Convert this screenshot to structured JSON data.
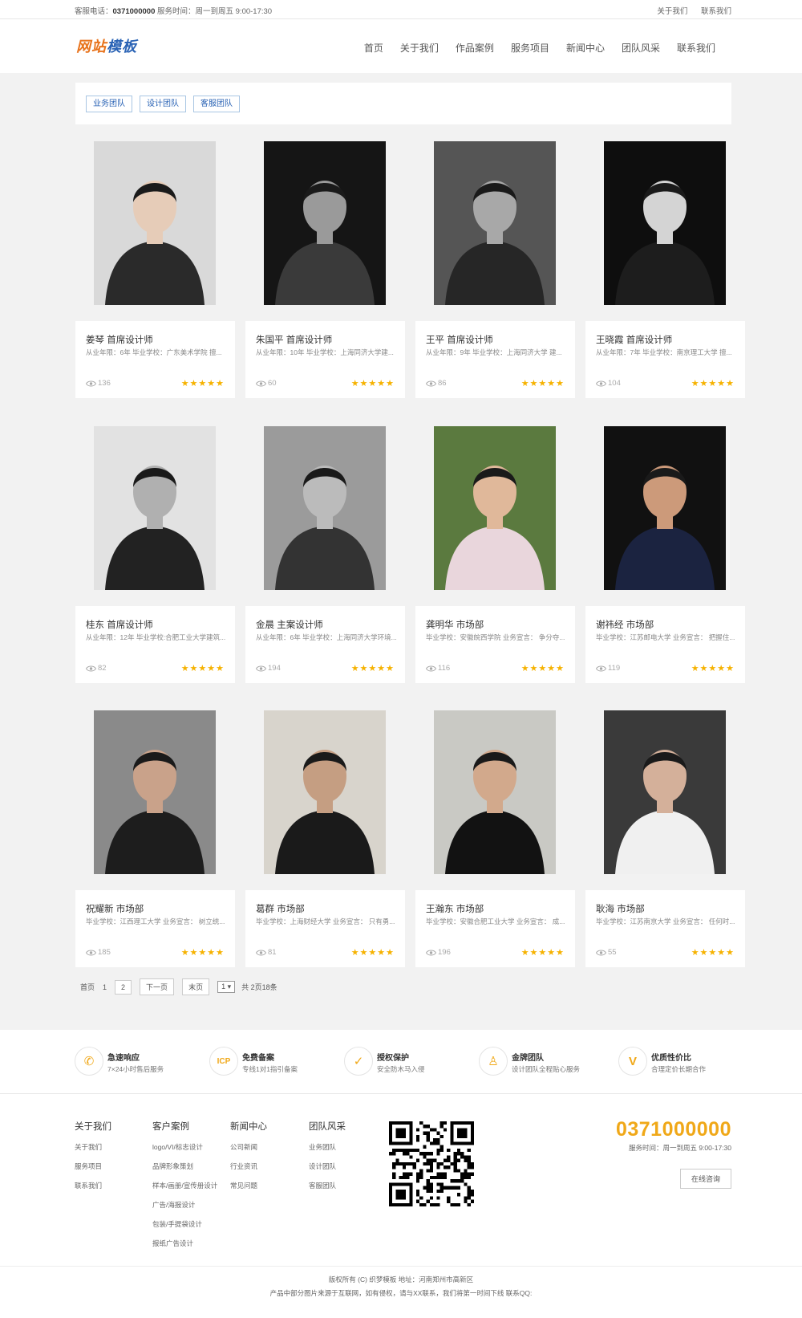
{
  "topbar": {
    "phone_label": "客服电话：",
    "phone": "0371000000",
    "hours": "服务时间：周一到周五 9:00-17:30",
    "links": [
      "关于我们",
      "联系我们"
    ]
  },
  "header": {
    "logo_a": "网站",
    "logo_b": "模板",
    "nav": [
      "首页",
      "关于我们",
      "作品案例",
      "服务项目",
      "新闻中心",
      "团队风采",
      "联系我们"
    ]
  },
  "filter_tabs": [
    "业务团队",
    "设计团队",
    "客服团队"
  ],
  "members": [
    {
      "name": "姜琴 首席设计师",
      "desc": "从业年限：6年 毕业学校：广东美术学院 擅...",
      "views": "136",
      "stars": "★★★★★"
    },
    {
      "name": "朱国平 首席设计师",
      "desc": "从业年限：10年 毕业学校：上海同济大学建...",
      "views": "60",
      "stars": "★★★★★"
    },
    {
      "name": "王平 首席设计师",
      "desc": "从业年限：9年 毕业学校：上海同济大学 建...",
      "views": "86",
      "stars": "★★★★★"
    },
    {
      "name": "王晓霞 首席设计师",
      "desc": "从业年限：7年 毕业学校：南京理工大学 擅...",
      "views": "104",
      "stars": "★★★★★"
    },
    {
      "name": "桂东 首席设计师",
      "desc": "从业年限：12年 毕业学校:合肥工业大学建筑...",
      "views": "82",
      "stars": "★★★★★"
    },
    {
      "name": "金晨 主案设计师",
      "desc": "从业年限：6年 毕业学校：上海同济大学环境...",
      "views": "194",
      "stars": "★★★★★"
    },
    {
      "name": "龚明华 市场部",
      "desc": "毕业学校：安徽皖西学院 业务宣言： 争分夺...",
      "views": "116",
      "stars": "★★★★★"
    },
    {
      "name": "谢祎经 市场部",
      "desc": "毕业学校：江苏邮电大学 业务宣言： 把握住...",
      "views": "119",
      "stars": "★★★★★"
    },
    {
      "name": "祝耀新 市场部",
      "desc": "毕业学校：江西理工大学 业务宣言： 树立统...",
      "views": "185",
      "stars": "★★★★★"
    },
    {
      "name": "葛群 市场部",
      "desc": "毕业学校：上海财经大学 业务宣言： 只有勇...",
      "views": "81",
      "stars": "★★★★★"
    },
    {
      "name": "王瀚东 市场部",
      "desc": "毕业学校：安徽合肥工业大学 业务宣言： 成...",
      "views": "196",
      "stars": "★★★★★"
    },
    {
      "name": "耿海 市场部",
      "desc": "毕业学校：江苏南京大学 业务宣言： 任何时...",
      "views": "55",
      "stars": "★★★★★"
    }
  ],
  "pager": {
    "first": "首页",
    "current": "1",
    "page2": "2",
    "next": "下一页",
    "last": "末页",
    "select": "1 ▾",
    "summary": "共 2页18条"
  },
  "services": [
    {
      "icon": "phone-icon",
      "glyph": "✆",
      "title": "急速响应",
      "desc": "7×24小时售后服务"
    },
    {
      "icon": "icp-icon",
      "glyph": "ICP",
      "title": "免费备案",
      "desc": "专线1对1指引备案"
    },
    {
      "icon": "shield-icon",
      "glyph": "✓",
      "title": "授权保护",
      "desc": "安全防木马入侵"
    },
    {
      "icon": "team-icon",
      "glyph": "♙",
      "title": "金牌团队",
      "desc": "设计团队全程贴心服务"
    },
    {
      "icon": "v-icon",
      "glyph": "V",
      "title": "优质性价比",
      "desc": "合理定价长期合作"
    }
  ],
  "footer": {
    "columns": [
      {
        "title": "关于我们",
        "links": [
          "关于我们",
          "服务项目",
          "联系我们"
        ]
      },
      {
        "title": "客户案例",
        "links": [
          "logo/VI/标志设计",
          "品牌形象策划",
          "样本/画册/宣传册设计",
          "广告/海报设计",
          "包装/手提袋设计",
          "报纸广告设计"
        ]
      },
      {
        "title": "新闻中心",
        "links": [
          "公司新闻",
          "行业资讯",
          "常见问题"
        ]
      },
      {
        "title": "团队风采",
        "links": [
          "业务团队",
          "设计团队",
          "客服团队"
        ]
      }
    ],
    "phone": "0371000000",
    "hours": "服务时间：周一到周五 9:00-17:30",
    "consult": "在线咨询",
    "copyright": "版权所有 (C) 织梦模板 地址：河南郑州市高新区",
    "notice": "产品中部分图片来源于互联网，如有侵权，请与XX联系，我们将第一时间下线 联系QQ:"
  },
  "colors": {
    "accent": "#f0a818",
    "brand_blue": "#2a63b5",
    "star": "#f6b200"
  }
}
